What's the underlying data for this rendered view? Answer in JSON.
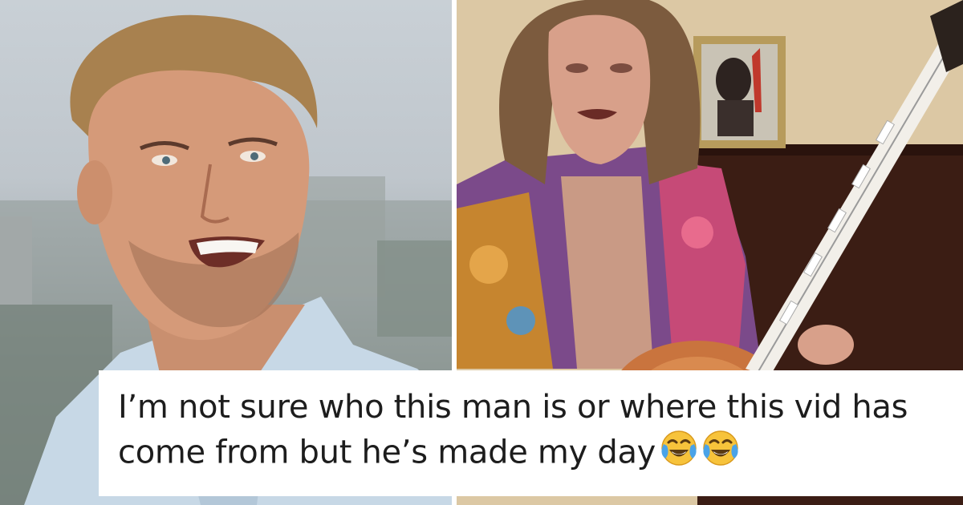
{
  "caption": {
    "text": "I’m not sure who this man is or where this vid has come from but he’s made my day",
    "emojis": [
      "face-with-tears-of-joy",
      "face-with-tears-of-joy"
    ]
  },
  "colors": {
    "caption_bg": "#ffffff",
    "caption_text": "#1d1d1d",
    "divider": "#ffffff"
  }
}
